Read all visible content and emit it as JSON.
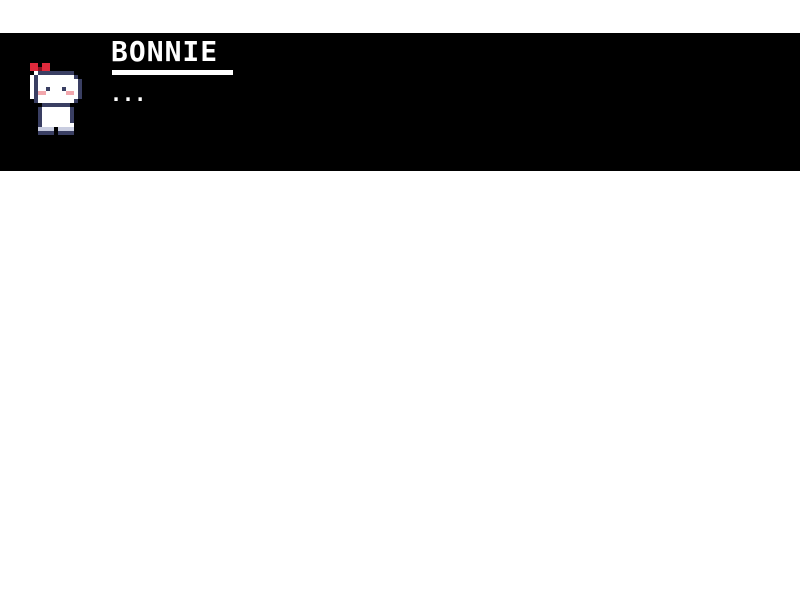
{
  "dialog": {
    "speaker_name": "BONNIE",
    "text": "...",
    "portrait_icon": "bonnie-portrait-icon"
  },
  "colors": {
    "dialog_background": "#000000",
    "text": "#ffffff",
    "page_background": "#ffffff",
    "bow": "#e02a3c",
    "blush": "#f2a7ad",
    "outline": "#3a3f63"
  }
}
